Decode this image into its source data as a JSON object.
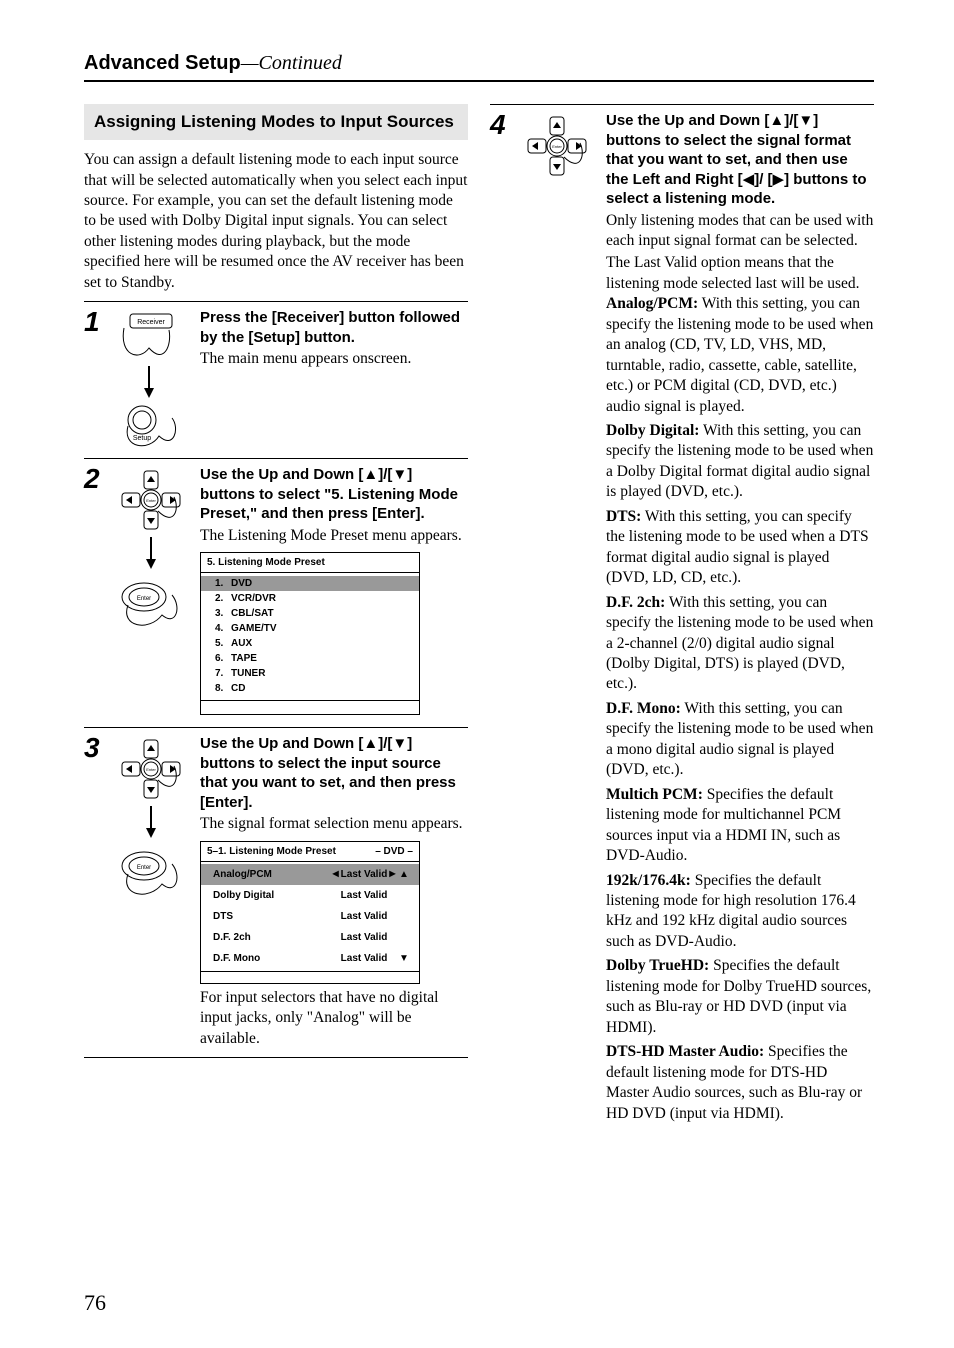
{
  "header": {
    "bold": "Advanced Setup",
    "sep": "—",
    "thin": "Continued"
  },
  "section_title": "Assigning Listening Modes to Input Sources",
  "intro": "You can assign a default listening mode to each input source that will be selected automatically when you select each input source. For example, you can set the default listening mode to be used with Dolby Digital input signals. You can select other listening modes during playback, but the mode specified here will be resumed once the AV receiver has been set to Standby.",
  "steps": {
    "s1": {
      "num": "1",
      "head": "Press the [Receiver] button followed by the [Setup] button.",
      "text": "The main menu appears onscreen."
    },
    "s2": {
      "num": "2",
      "head_a": "Use the Up and Down [",
      "head_b": "]/[",
      "head_c": "] buttons to select \"5. Listening Mode Preset,\" and then press [Enter].",
      "text": "The Listening Mode Preset menu appears.",
      "menu": {
        "title": "5.  Listening Mode Preset",
        "items": [
          {
            "n": "1.",
            "t": "DVD"
          },
          {
            "n": "2.",
            "t": "VCR/DVR"
          },
          {
            "n": "3.",
            "t": "CBL/SAT"
          },
          {
            "n": "4.",
            "t": "GAME/TV"
          },
          {
            "n": "5.",
            "t": "AUX"
          },
          {
            "n": "6.",
            "t": "TAPE"
          },
          {
            "n": "7.",
            "t": "TUNER"
          },
          {
            "n": "8.",
            "t": "CD"
          }
        ]
      }
    },
    "s3": {
      "num": "3",
      "head_a": "Use the Up and Down [",
      "head_b": "]/[",
      "head_c": "] buttons to select the input source that you want to set, and then press [Enter].",
      "text": "The signal format selection menu appears.",
      "menu": {
        "title_left": "5–1.  Listening Mode Preset",
        "title_right": "–   DVD   –",
        "rows": [
          {
            "lbl": "Analog/PCM",
            "val": "Last Valid",
            "sel": true
          },
          {
            "lbl": "Dolby Digital",
            "val": "Last Valid"
          },
          {
            "lbl": "DTS",
            "val": "Last Valid"
          },
          {
            "lbl": "D.F. 2ch",
            "val": "Last Valid"
          },
          {
            "lbl": "D.F. Mono",
            "val": "Last Valid"
          }
        ]
      },
      "after": "For input selectors that have no digital input jacks, only \"Analog\" will be available."
    },
    "s4": {
      "num": "4",
      "head_a": "Use the Up and Down [",
      "head_b": "]/[",
      "head_c": "] buttons to select the signal format that you want to set, and then use the Left and Right [",
      "head_d": "]/ [",
      "head_e": "] buttons to select a listening mode.",
      "p1": "Only listening modes that can be used with each input signal format can be selected.",
      "p2": "The Last Valid option means that the listening mode selected last will be used.",
      "defs": [
        {
          "t": "Analog/PCM:",
          "d": " With this setting, you can specify the listening mode to be used when an analog (CD, TV, LD, VHS, MD, turntable, radio, cassette, cable, satellite, etc.) or PCM digital (CD, DVD, etc.) audio signal is played."
        },
        {
          "t": "Dolby Digital:",
          "d": " With this setting, you can specify the listening mode to be used when a Dolby Digital format digital audio signal is played (DVD, etc.)."
        },
        {
          "t": "DTS:",
          "d": " With this setting, you can specify the listening mode to be used when a DTS format digital audio signal is played (DVD, LD, CD, etc.)."
        },
        {
          "t": "D.F. 2ch:",
          "d": " With this setting, you can specify the listening mode to be used when a 2-channel (2/0) digital audio signal (Dolby Digital, DTS) is played (DVD, etc.)."
        },
        {
          "t": "D.F. Mono:",
          "d": " With this setting, you can specify the listening mode to be used when a mono digital audio signal is played (DVD, etc.)."
        },
        {
          "t": "Multich PCM:",
          "d": " Specifies the default listening mode for multichannel PCM sources input via a HDMI IN, such as DVD-Audio."
        },
        {
          "t": "192k/176.4k:",
          "d": " Specifies the default listening mode for high resolution 176.4 kHz and 192 kHz digital audio sources such as DVD-Audio."
        },
        {
          "t": "Dolby TrueHD:",
          "d": " Specifies the default listening mode for Dolby TrueHD sources, such as Blu-ray or HD DVD (input via HDMI)."
        },
        {
          "t": "DTS-HD Master Audio:",
          "d": " Specifies the default listening mode for DTS-HD Master Audio sources, such as Blu-ray or HD DVD (input via HDMI)."
        }
      ]
    }
  },
  "page_number": "76",
  "icons": {
    "receiver": "Receiver",
    "setup": "Setup",
    "enter": "Enter"
  }
}
